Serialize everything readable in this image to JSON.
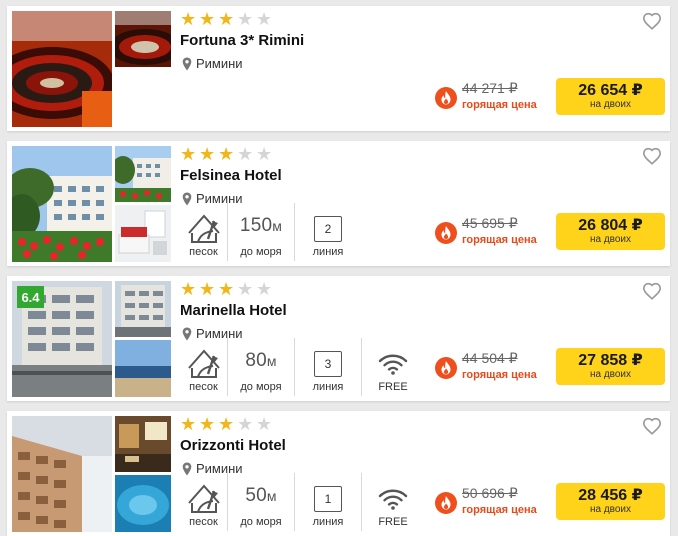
{
  "colors": {
    "accent": "#ffd319",
    "star": "#f2b619",
    "hot": "#e94a1b",
    "rating": "#33a830"
  },
  "hotels": [
    {
      "name": "Fortuna 3* Rimini",
      "stars": 3,
      "location": "Римини",
      "old_price": "44 271 ₽",
      "hot_label": "горящая цена",
      "price": "26 654 ₽",
      "price_note": "на двоих"
    },
    {
      "name": "Felsinea Hotel",
      "stars": 3,
      "location": "Римини",
      "sand_label": "песок",
      "distance": "150",
      "distance_unit": "м",
      "distance_label": "до моря",
      "line": "2",
      "line_label": "линия",
      "old_price": "45 695 ₽",
      "hot_label": "горящая цена",
      "price": "26 804 ₽",
      "price_note": "на двоих"
    },
    {
      "name": "Marinella Hotel",
      "rating": "6.4",
      "stars": 3,
      "location": "Римини",
      "sand_label": "песок",
      "distance": "80",
      "distance_unit": "м",
      "distance_label": "до моря",
      "line": "3",
      "line_label": "линия",
      "wifi_label": "FREE",
      "old_price": "44 504 ₽",
      "hot_label": "горящая цена",
      "price": "27 858 ₽",
      "price_note": "на двоих"
    },
    {
      "name": "Orizzonti Hotel",
      "stars": 3,
      "location": "Римини",
      "sand_label": "песок",
      "distance": "50",
      "distance_unit": "м",
      "distance_label": "до моря",
      "line": "1",
      "line_label": "линия",
      "wifi_label": "FREE",
      "old_price": "50 696 ₽",
      "hot_label": "горящая цена",
      "price": "28 456 ₽",
      "price_note": "на двоих"
    }
  ]
}
